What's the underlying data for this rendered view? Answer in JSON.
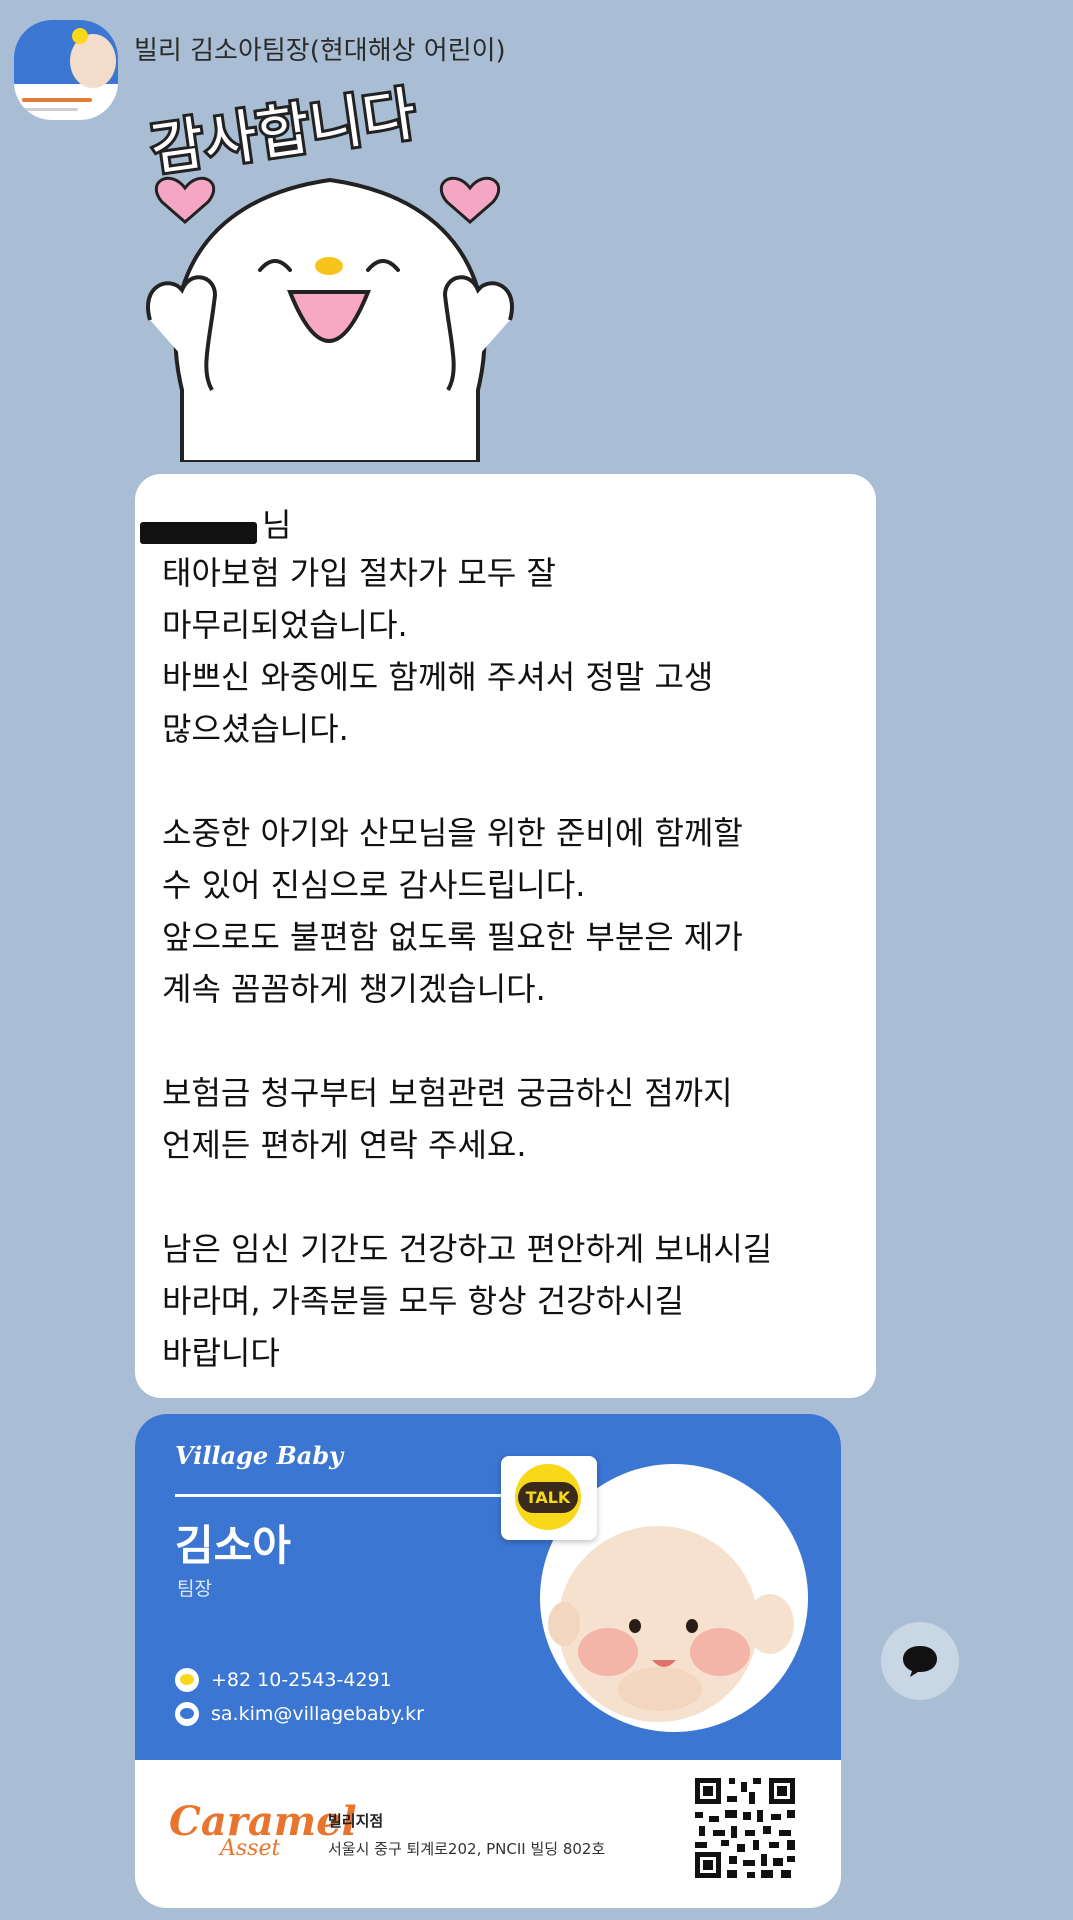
{
  "chat": {
    "sender_name": "빌리 김소아팀장(현대해상 어린이)",
    "sticker_text": "감사합니다",
    "message_prefix": "님",
    "message_body": "태아보험 가입 절차가 모두 잘\n마무리되었습니다.\n바쁘신 와중에도 함께해 주셔서 정말 고생\n많으셨습니다.\n\n소중한 아기와 산모님을 위한 준비에 함께할\n수 있어 진심으로 감사드립니다.\n앞으로도 불편함 없도록 필요한 부분은 제가\n계속 꼼꼼하게 챙기겠습니다.\n\n보험금 청구부터 보험관련 궁금하신 점까지\n언제든 편하게 연락 주세요.\n\n남은 임신 기간도 건강하고 편안하게 보내시길\n바라며, 가족분들 모두 항상 건강하시길\n바랍니다"
  },
  "card": {
    "brand": "Village Baby",
    "name": "김소아",
    "role": "팀장",
    "phone": "+82 10-2543-4291",
    "email": "sa.kim@villagebaby.kr",
    "talk_badge": "TALK",
    "company_logo_main": "Caramel",
    "company_logo_sub": "Asset",
    "branch_name": "빌리지점",
    "branch_address": "서울시 중구 퇴계로202,  PNCII 빌딩 802호"
  },
  "colors": {
    "background": "#a9bed4",
    "card_blue": "#3b76d2",
    "caramel_orange": "#e8742e",
    "kakao_yellow": "#f7d91a"
  },
  "icons": {
    "phone": "kakao-talk-icon",
    "email": "mail-icon",
    "fab": "speech-bubble-icon"
  }
}
